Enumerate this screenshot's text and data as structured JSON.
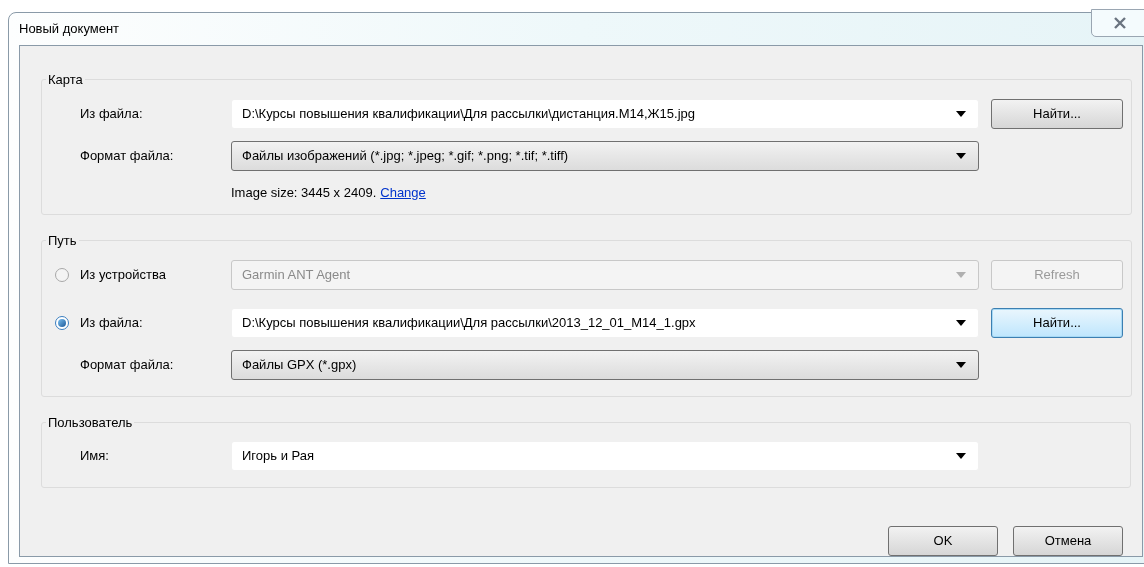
{
  "window": {
    "title": "Новый документ"
  },
  "sections": [
    {
      "title": "Карта",
      "rows": [
        {
          "kind": "field",
          "label": "Из файла:",
          "value": "D:\\Курсы повышения квалификации\\Для рассылки\\дистанция.М14,Ж15.jpg",
          "editable": true,
          "disabled": false,
          "button": {
            "label": "Найти...",
            "disabled": false,
            "focused": false
          }
        },
        {
          "kind": "field",
          "label": "Формат файла:",
          "value": "Файлы изображений (*.jpg; *.jpeg; *.gif; *.png; *.tif; *.tiff)",
          "editable": false,
          "disabled": false
        },
        {
          "kind": "info",
          "text": "Image size: 3445 x 2409.",
          "link": "Change"
        }
      ]
    },
    {
      "title": "Путь",
      "rows": [
        {
          "kind": "field",
          "label": "Из устройства",
          "selected": false,
          "value": "Garmin ANT Agent",
          "disabled": true,
          "button": {
            "label": "Refresh",
            "disabled": true
          }
        },
        {
          "kind": "field",
          "label": "Из файла:",
          "selected": true,
          "value": "D:\\Курсы повышения квалификации\\Для рассылки\\2013_12_01_M14_1.gpx",
          "editable": true,
          "disabled": false,
          "button": {
            "label": "Найти...",
            "disabled": false,
            "focused": true
          }
        },
        {
          "kind": "field",
          "label": "Формат файла:",
          "value": "Файлы GPX (*.gpx)",
          "editable": false,
          "disabled": false
        }
      ]
    },
    {
      "title": "Пользователь",
      "rows": [
        {
          "kind": "field",
          "label": "Имя:",
          "value": "Игорь и Рая",
          "editable": true,
          "disabled": false
        }
      ]
    }
  ],
  "buttons": [
    {
      "label": "OK"
    },
    {
      "label": "Отмена"
    }
  ]
}
